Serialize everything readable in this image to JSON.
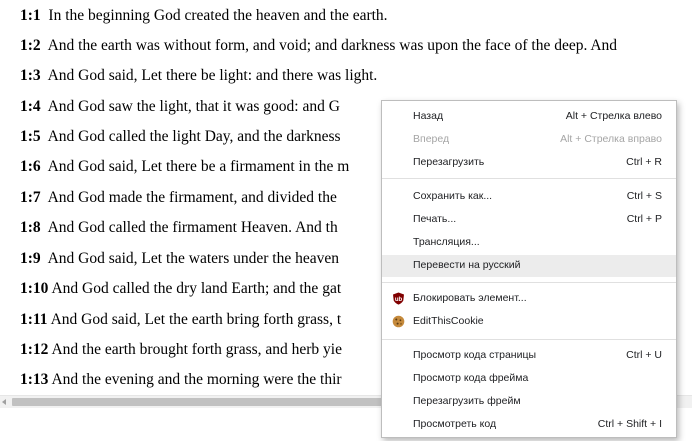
{
  "verses": [
    {
      "ref": "1:1",
      "text": "In the beginning God created the heaven and the earth."
    },
    {
      "ref": "1:2",
      "text": "And the earth was without form, and void; and darkness was upon the face of the deep. And"
    },
    {
      "ref": "1:3",
      "text": "And God said, Let there be light: and there was light."
    },
    {
      "ref": "1:4",
      "text": "And God saw the light, that it was good: and G"
    },
    {
      "ref": "1:5",
      "text": "And God called the light Day, and the darkness"
    },
    {
      "ref": "1:6",
      "text": "And God said, Let there be a firmament in the m"
    },
    {
      "ref": "1:7",
      "text": "And God made the firmament, and divided the"
    },
    {
      "ref": "1:8",
      "text": "And God called the firmament Heaven. And th"
    },
    {
      "ref": "1:9",
      "text": "And God said, Let the waters under the heaven"
    },
    {
      "ref": "1:10",
      "text": "And God called the dry land Earth; and the gat"
    },
    {
      "ref": "1:11",
      "text": "And God said, Let the earth bring forth grass, t"
    },
    {
      "ref": "1:12",
      "text": "And the earth brought forth grass, and herb yie"
    },
    {
      "ref": "1:13",
      "text": "And the evening and the morning were the thir"
    }
  ],
  "context_menu": {
    "items": [
      {
        "label": "Назад",
        "shortcut": "Alt + Стрелка влево"
      },
      {
        "label": "Вперед",
        "shortcut": "Alt + Стрелка вправо"
      },
      {
        "label": "Перезагрузить",
        "shortcut": "Ctrl + R"
      },
      {
        "label": "Сохранить как...",
        "shortcut": "Ctrl + S"
      },
      {
        "label": "Печать...",
        "shortcut": "Ctrl + P"
      },
      {
        "label": "Трансляция..."
      },
      {
        "label": "Перевести на русский"
      },
      {
        "label": "Блокировать элемент...",
        "icon": "ublock-origin-icon"
      },
      {
        "label": "EditThisCookie",
        "icon": "cookie-icon"
      },
      {
        "label": "Просмотр кода страницы",
        "shortcut": "Ctrl + U"
      },
      {
        "label": "Просмотр кода фрейма"
      },
      {
        "label": "Перезагрузить фрейм"
      },
      {
        "label": "Просмотреть код",
        "shortcut": "Ctrl + Shift + I"
      }
    ],
    "disabled_item": "Вперед",
    "highlighted_item": "Перевести на русский"
  },
  "colors": {
    "menu_hover": "#ececec",
    "disabled_text": "#a5a5a5",
    "ublock_red": "#800000",
    "cookie_brown": "#c58a3c"
  }
}
